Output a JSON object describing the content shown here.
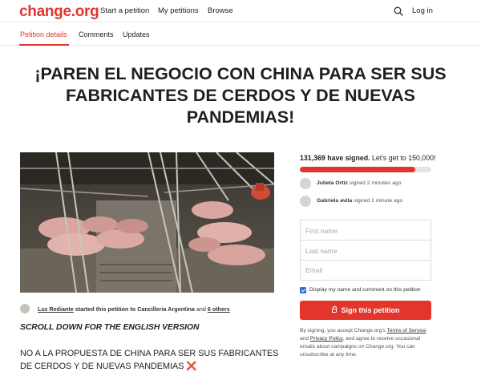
{
  "brand": {
    "logo": "change.org",
    "accent_color": "#e2362c"
  },
  "nav": {
    "start_petition": "Start a petition",
    "my_petitions": "My petitions",
    "browse": "Browse",
    "search_icon": "search-icon",
    "login": "Log in"
  },
  "tabs": [
    {
      "label": "Petition details",
      "active": true
    },
    {
      "label": "Comments",
      "active": false
    },
    {
      "label": "Updates",
      "active": false
    }
  ],
  "petition": {
    "title_line1": "¡PAREN EL NEGOCIO CON CHINA PARA SER SUS",
    "title_line2": "FABRICANTES DE CERDOS Y DE NUEVAS",
    "title_line3": "PANDEMIAS!",
    "starter_name": "Luz Rediante",
    "starter_mid": " started this petition to ",
    "starter_target": "Cancilleria Argentina",
    "starter_and": " and ",
    "starter_others": "6 others",
    "english_note": "SCROLL DOWN FOR THE ENGLISH VERSION",
    "body_line1": "NO A LA PROPUESTA DE CHINA PARA SER SUS FABRICANTES",
    "body_line2": "DE CERDOS Y DE NUEVAS PANDEMIAS ",
    "body_mark": "❌"
  },
  "signatures": {
    "count_text": "131,369 have signed.",
    "goal_text": " Let's get to 150,000!",
    "progress_fraction": 0.876,
    "recent": [
      {
        "name": "Julieta Ortiz",
        "action": " signed 2 minutes ago"
      },
      {
        "name": "Gabriela avila",
        "action": " signed 1 minute ago"
      }
    ]
  },
  "form": {
    "first_name_placeholder": "First name",
    "last_name_placeholder": "Last name",
    "email_placeholder": "Email",
    "display_checkbox_label": "Display my name and comment on this petition",
    "display_checked": true,
    "sign_button": "Sign this petition"
  },
  "legal": {
    "part1": "By signing, you accept Change.org's ",
    "terms": "Terms of Service",
    "part2": " and ",
    "privacy": "Privacy Policy",
    "part3": ", and agree to receive occasional emails about campaigns on Change.org. You can unsubscribe at any time."
  }
}
